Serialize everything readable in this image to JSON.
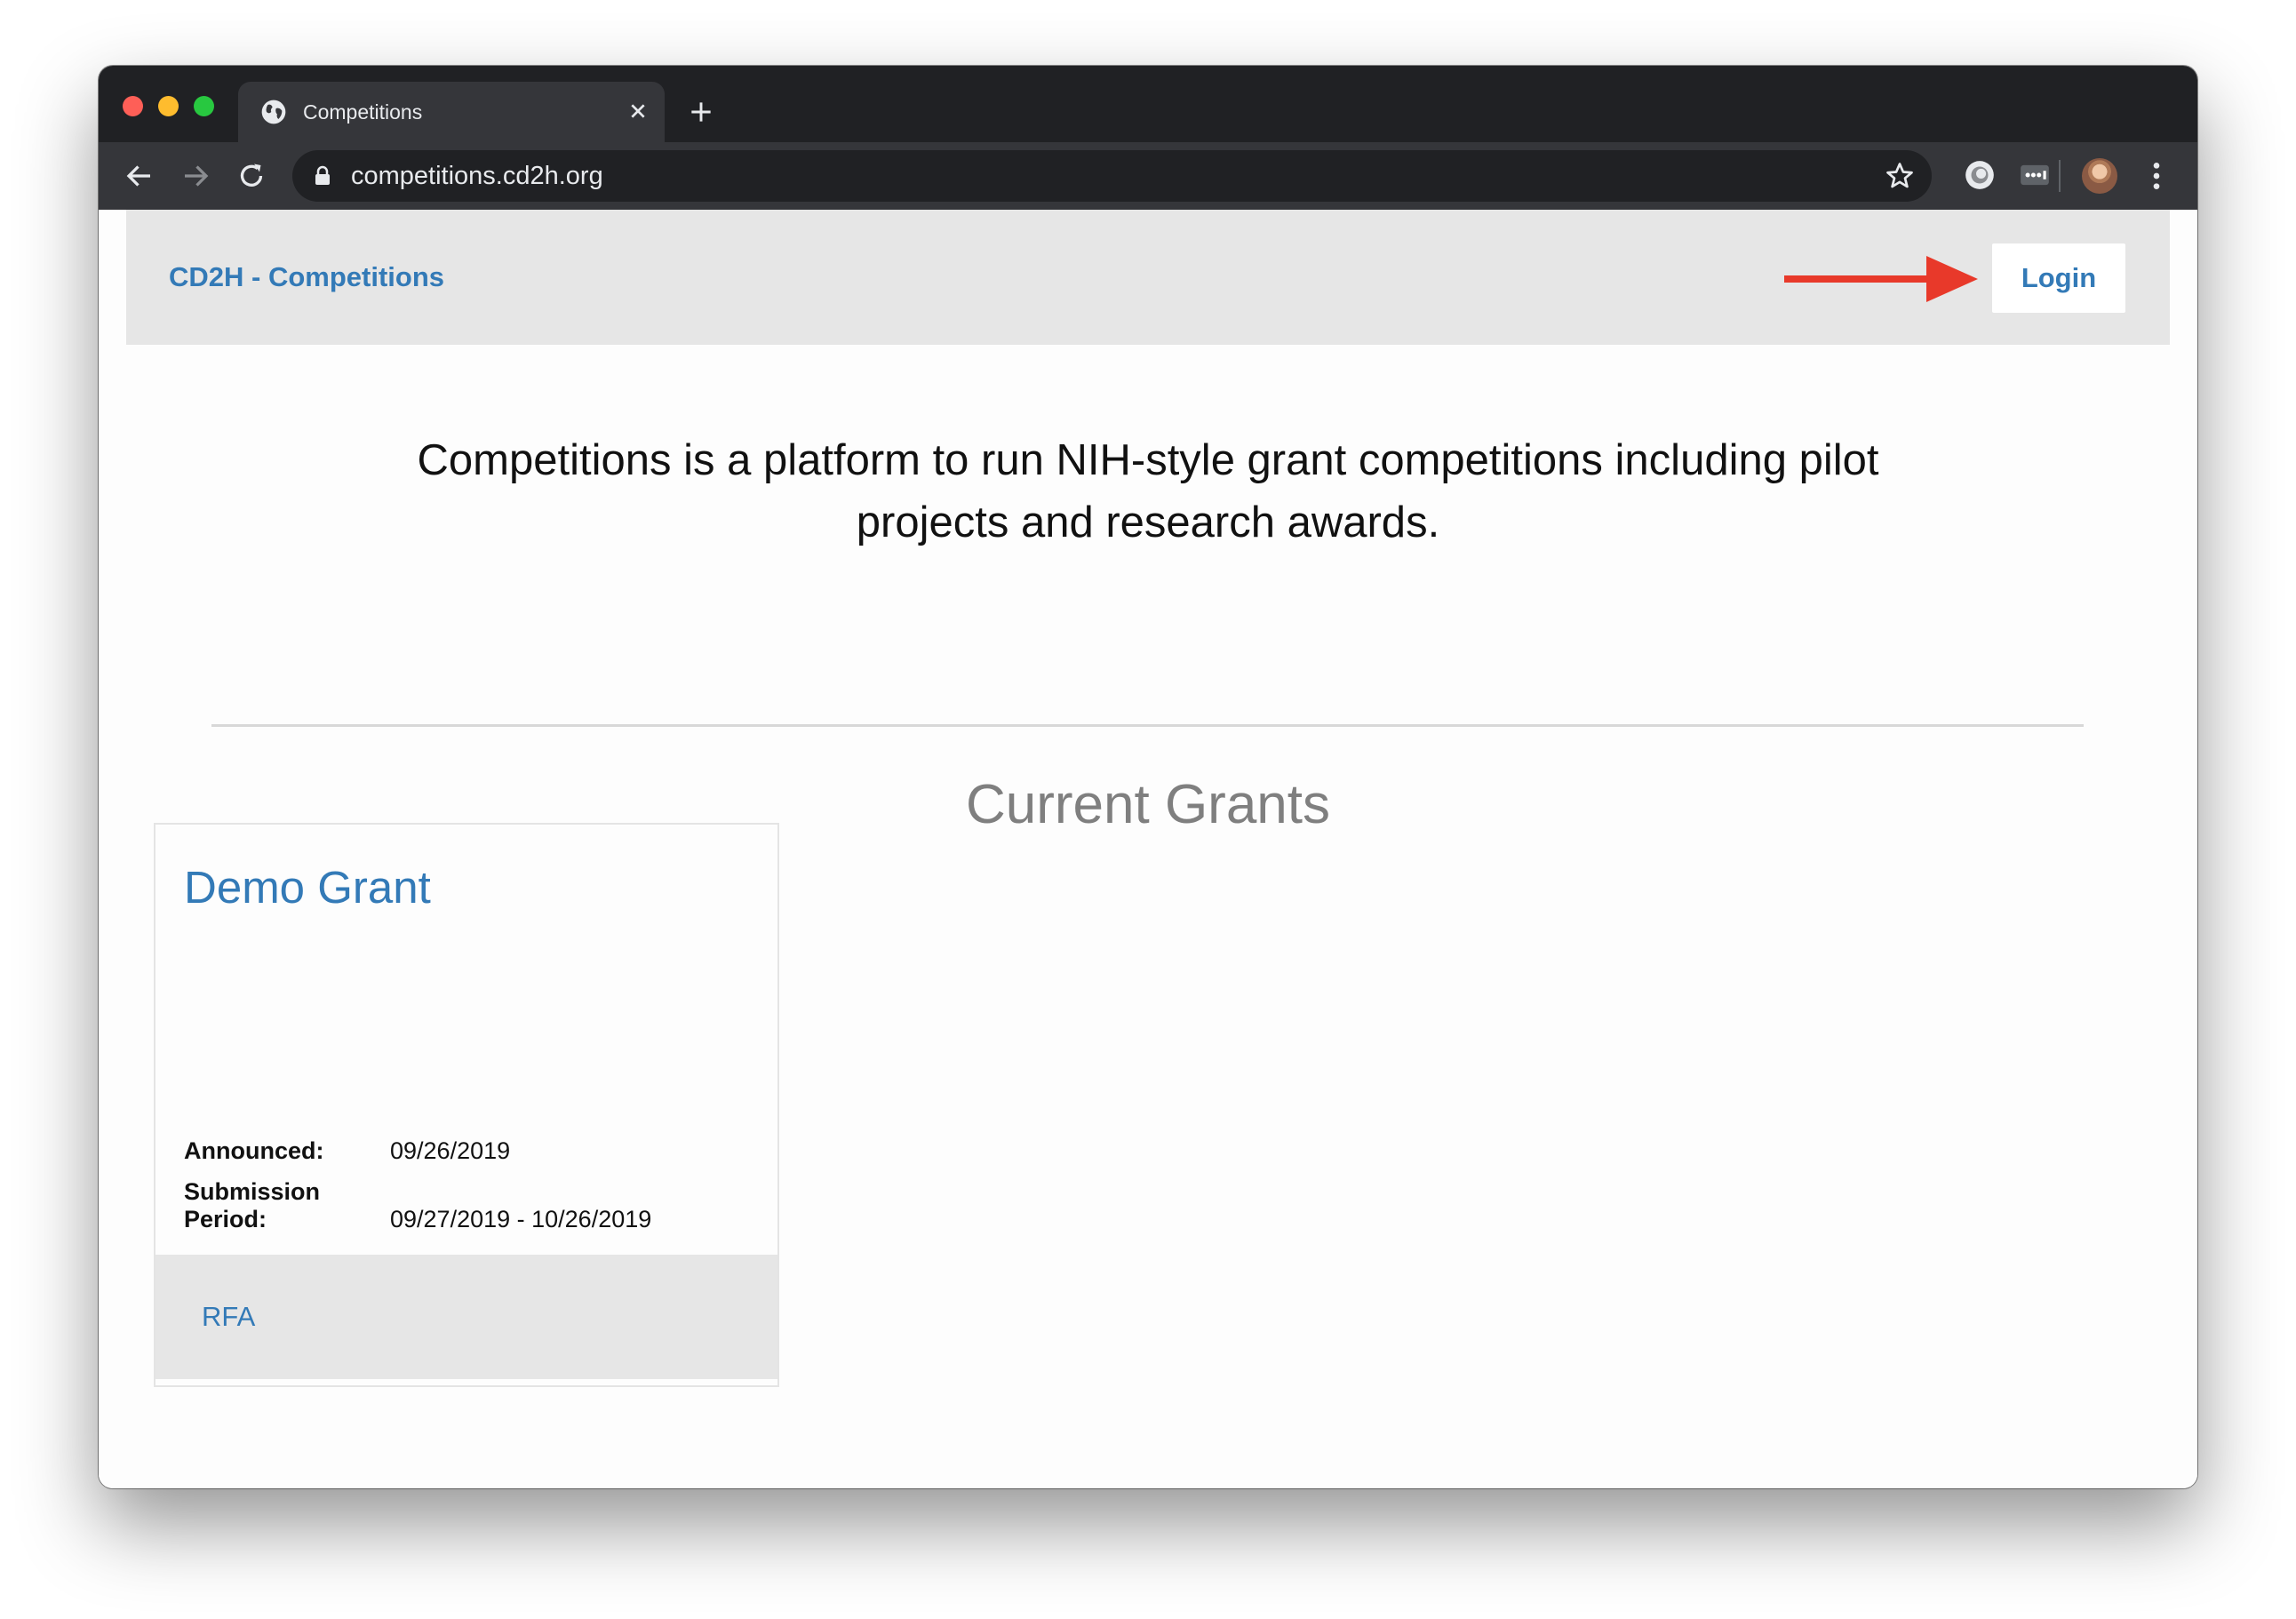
{
  "browser": {
    "tab_title": "Competitions",
    "url": "competitions.cd2h.org",
    "icons": {
      "tab_favicon": "globe-icon",
      "close_tab": "close-icon",
      "new_tab": "plus-icon",
      "back": "arrow-left-icon",
      "forward": "arrow-right-icon",
      "reload": "reload-icon",
      "secure": "lock-icon",
      "bookmark": "star-icon",
      "extension_1": "circle-extension-icon",
      "extension_2": "dots-extension-icon",
      "profile": "avatar-icon",
      "menu": "more-vert-icon"
    }
  },
  "navbar": {
    "brand": "CD2H - Competitions",
    "login_label": "Login",
    "annotation": "red-arrow-pointing-to-login"
  },
  "intro": {
    "text": "Competitions is a platform to run NIH-style grant competitions including pilot projects and research awards."
  },
  "grants_section": {
    "title": "Current Grants",
    "cards": [
      {
        "title": "Demo Grant",
        "announced_label": "Announced:",
        "announced_value": "09/26/2019",
        "submission_label_line1": "Submission",
        "submission_label_line2": "Period:",
        "submission_value": "09/27/2019 - 10/26/2019",
        "footer_link": "RFA"
      }
    ]
  },
  "colors": {
    "link_blue": "#337ab7",
    "annotation_red": "#e8392a",
    "navbar_bg": "#e6e6e6",
    "chrome_dark": "#202124"
  }
}
